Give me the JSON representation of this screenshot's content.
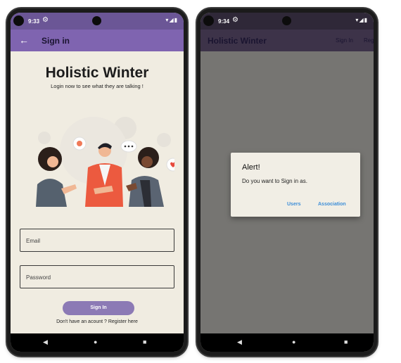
{
  "left_phone": {
    "status_time": "9:33",
    "appbar": {
      "back_icon": "arrow-left-icon",
      "title": "Sign in"
    },
    "headline": "Holistic Winter",
    "tagline": "Login now to see what they are talking !",
    "email_placeholder": "Email",
    "password_placeholder": "Password",
    "signin_button": "Sign In",
    "account_prompt": "Don't have an acount ? Register here"
  },
  "right_phone": {
    "status_time": "9:34",
    "appbar": {
      "title": "Holistic Winter",
      "signin_action": "Sign In",
      "register_action": "Register"
    },
    "dialog": {
      "title": "Alert!",
      "message": "Do you want to Sign in as.",
      "users_button": "Users",
      "association_button": "Association"
    }
  },
  "colors": {
    "appbar_purple": "#7f64b0",
    "button_purple": "#8c7ab5",
    "screen_background": "#f0ece1",
    "dialog_action_blue": "#3d8ed8",
    "scrim_gray": "#767572"
  }
}
